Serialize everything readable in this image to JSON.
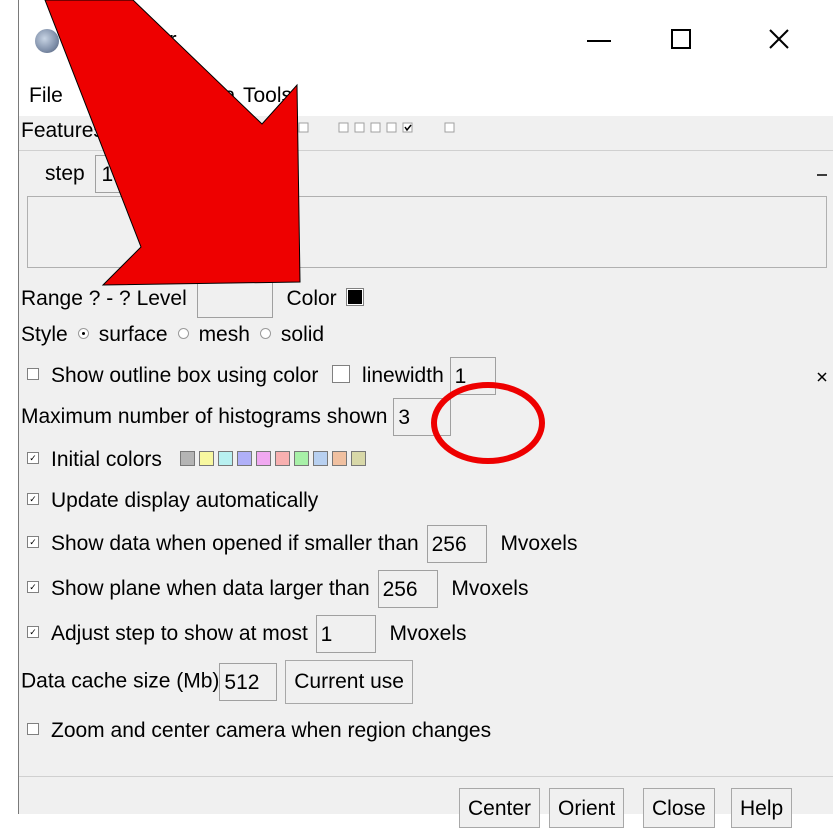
{
  "window": {
    "title": "me Viewer"
  },
  "menu": {
    "file": "File",
    "features": "F",
    "features_tail": "s",
    "data": "Data",
    "tools": "Tools"
  },
  "features_row": {
    "label": "Features"
  },
  "step": {
    "label": "step",
    "value": "1"
  },
  "range_row": {
    "range": "Range ? - ? Level",
    "level_value": "",
    "color_label": "Color",
    "color_value": "#000000"
  },
  "style_row": {
    "label": "Style",
    "options": [
      "surface",
      "mesh",
      "solid"
    ],
    "selected": "surface"
  },
  "outline_row": {
    "label": "Show outline box using color",
    "linewidth_label": "linewidth",
    "linewidth_value": "1"
  },
  "histograms_row": {
    "label": "Maximum number of histograms shown",
    "value": "3"
  },
  "initial_colors": {
    "label": "Initial colors",
    "colors": [
      "#b4b4b4",
      "#f8f8a0",
      "#b8f0f0",
      "#b0b0f8",
      "#f0a8f0",
      "#f8b0b0",
      "#a8f0a8",
      "#b8d0f0",
      "#f0c0a0",
      "#d8d8a8"
    ]
  },
  "update_row": {
    "label": "Update display automatically"
  },
  "show_data_row": {
    "label": "Show data when opened if smaller than",
    "value": "256",
    "unit": "Mvoxels"
  },
  "show_plane_row": {
    "label": "Show plane when data larger than",
    "value": "256",
    "unit": "Mvoxels"
  },
  "adjust_step_row": {
    "label": "Adjust step to show at most",
    "value": "1",
    "unit": "Mvoxels"
  },
  "cache_row": {
    "label": "Data cache size (Mb)",
    "value": "512",
    "button": "Current use"
  },
  "zoom_row": {
    "label": "Zoom and center camera when region changes"
  },
  "bottom_buttons": {
    "center": "Center",
    "orient": "Orient",
    "close": "Close",
    "help": "Help"
  },
  "annotations": {
    "arrow_color": "#ee0000",
    "circle_color": "#ee0000"
  }
}
